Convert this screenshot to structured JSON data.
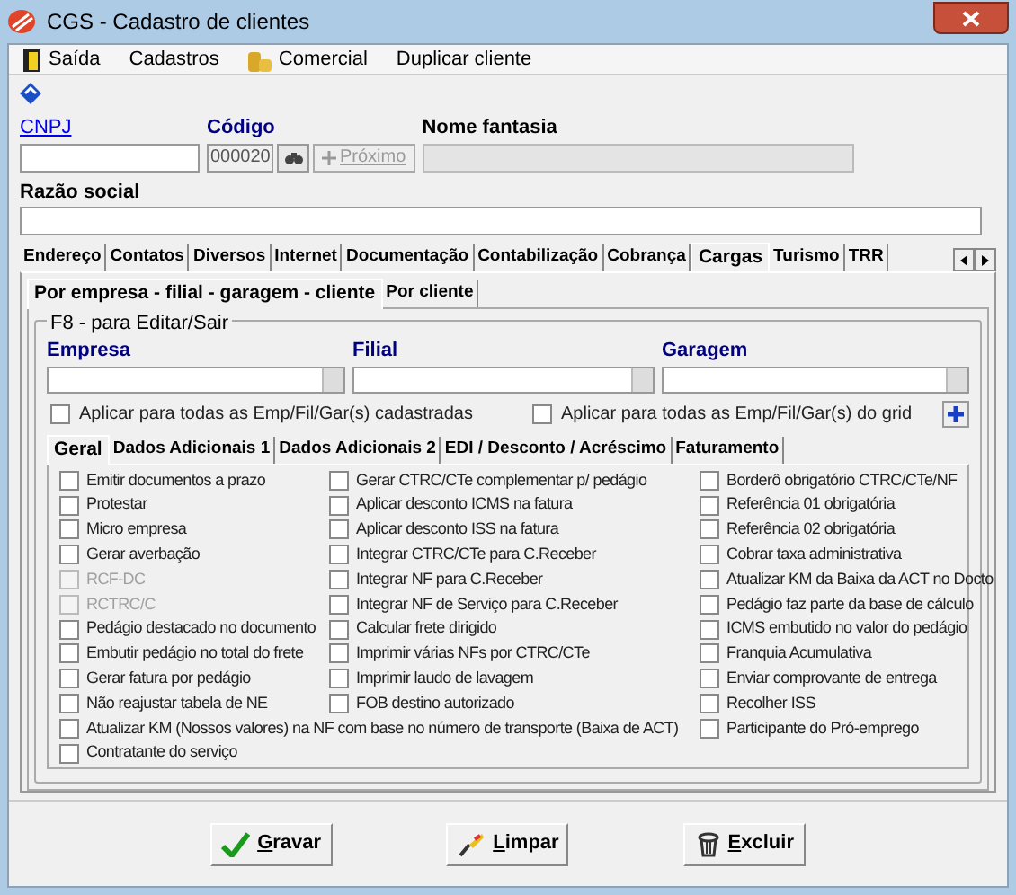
{
  "window": {
    "title": "CGS - Cadastro de clientes"
  },
  "menu": [
    {
      "label": "Saída"
    },
    {
      "label": "Cadastros"
    },
    {
      "label": "Comercial"
    },
    {
      "label": "Duplicar cliente"
    }
  ],
  "header": {
    "cnpj_label": "CNPJ",
    "codigo_label": "Código",
    "codigo_value": "000020",
    "proximo_button": "Próximo",
    "proximo_disabled": true,
    "nome_fantasia_label": "Nome fantasia",
    "razao_social_label": "Razão social"
  },
  "tabs": [
    {
      "label": "Endereço",
      "selected": false
    },
    {
      "label": "Contatos",
      "selected": false
    },
    {
      "label": "Diversos",
      "selected": false
    },
    {
      "label": "Internet",
      "selected": false
    },
    {
      "label": "Documentação",
      "selected": false
    },
    {
      "label": "Contabilização",
      "selected": false
    },
    {
      "label": "Cobrança",
      "selected": false
    },
    {
      "label": "Cargas",
      "selected": true
    },
    {
      "label": "Turismo",
      "selected": false
    },
    {
      "label": "TRR",
      "selected": false
    }
  ],
  "subtabs": [
    {
      "label": "Por empresa - filial - garagem - cliente",
      "selected": true
    },
    {
      "label": "Por cliente",
      "selected": false
    }
  ],
  "group": {
    "title": "F8 - para Editar/Sair",
    "empresa_label": "Empresa",
    "filial_label": "Filial",
    "garagem_label": "Garagem",
    "apply_options": [
      {
        "label": "Aplicar para todas as Emp/Fil/Gar(s) cadastradas",
        "checked": false
      },
      {
        "label": "Aplicar para todas as Emp/Fil/Gar(s) do grid",
        "checked": false
      }
    ]
  },
  "inner_tabs": [
    {
      "label": "Geral",
      "selected": true
    },
    {
      "label": "Dados Adicionais 1",
      "selected": false
    },
    {
      "label": "Dados Adicionais 2",
      "selected": false
    },
    {
      "label": "EDI / Desconto / Acréscimo",
      "selected": false
    },
    {
      "label": "Faturamento",
      "selected": false
    }
  ],
  "options_columns": [
    [
      {
        "label": "Emitir documentos a prazo",
        "checked": false,
        "disabled": false
      },
      {
        "label": "Protestar",
        "checked": false,
        "disabled": false
      },
      {
        "label": "Micro empresa",
        "checked": false,
        "disabled": false
      },
      {
        "label": "Gerar averbação",
        "checked": false,
        "disabled": false
      },
      {
        "label": "RCF-DC",
        "checked": false,
        "disabled": true
      },
      {
        "label": "RCTRC/C",
        "checked": false,
        "disabled": true
      },
      {
        "label": "Pedágio destacado no documento",
        "checked": false,
        "disabled": false
      },
      {
        "label": "Embutir pedágio no total do frete",
        "checked": false,
        "disabled": false
      },
      {
        "label": "Gerar fatura por pedágio",
        "checked": false,
        "disabled": false
      },
      {
        "label": "Não reajustar tabela de NE",
        "checked": false,
        "disabled": false
      },
      {
        "label": "Atualizar KM (Nossos valores) na NF com base no número de transporte (Baixa de ACT)",
        "checked": false,
        "disabled": false
      },
      {
        "label": "Contratante do serviço",
        "checked": false,
        "disabled": false
      }
    ],
    [
      {
        "label": "Gerar CTRC/CTe complementar p/ pedágio",
        "checked": false,
        "disabled": false
      },
      {
        "label": "Aplicar desconto ICMS na fatura",
        "checked": false,
        "disabled": false
      },
      {
        "label": "Aplicar desconto ISS na fatura",
        "checked": false,
        "disabled": false
      },
      {
        "label": "Integrar CTRC/CTe para C.Receber",
        "checked": false,
        "disabled": false
      },
      {
        "label": "Integrar NF para C.Receber",
        "checked": false,
        "disabled": false
      },
      {
        "label": "Integrar NF de Serviço para C.Receber",
        "checked": false,
        "disabled": false
      },
      {
        "label": "Calcular frete dirigido",
        "checked": false,
        "disabled": false
      },
      {
        "label": "Imprimir várias NFs por CTRC/CTe",
        "checked": false,
        "disabled": false
      },
      {
        "label": "Imprimir laudo de lavagem",
        "checked": false,
        "disabled": false
      },
      {
        "label": "FOB destino autorizado",
        "checked": false,
        "disabled": false
      }
    ],
    [
      {
        "label": "Borderô obrigatório  CTRC/CTe/NF",
        "checked": false,
        "disabled": false
      },
      {
        "label": "Referência 01 obrigatória",
        "checked": false,
        "disabled": false
      },
      {
        "label": "Referência 02 obrigatória",
        "checked": false,
        "disabled": false
      },
      {
        "label": "Cobrar taxa administrativa",
        "checked": false,
        "disabled": false
      },
      {
        "label": "Atualizar KM da Baixa da ACT no Docto",
        "checked": false,
        "disabled": false
      },
      {
        "label": "Pedágio faz parte da base de cálculo",
        "checked": false,
        "disabled": false
      },
      {
        "label": "ICMS embutido no valor do pedágio",
        "checked": false,
        "disabled": false
      },
      {
        "label": "Franquia Acumulativa",
        "checked": false,
        "disabled": false
      },
      {
        "label": "Enviar comprovante de entrega",
        "checked": false,
        "disabled": false
      },
      {
        "label": "Recolher ISS",
        "checked": false,
        "disabled": false
      },
      {
        "label": "Participante do Pró-emprego",
        "checked": false,
        "disabled": false
      }
    ]
  ],
  "buttons": [
    {
      "label": "Gravar"
    },
    {
      "label": "Limpar"
    },
    {
      "label": "Excluir"
    }
  ]
}
